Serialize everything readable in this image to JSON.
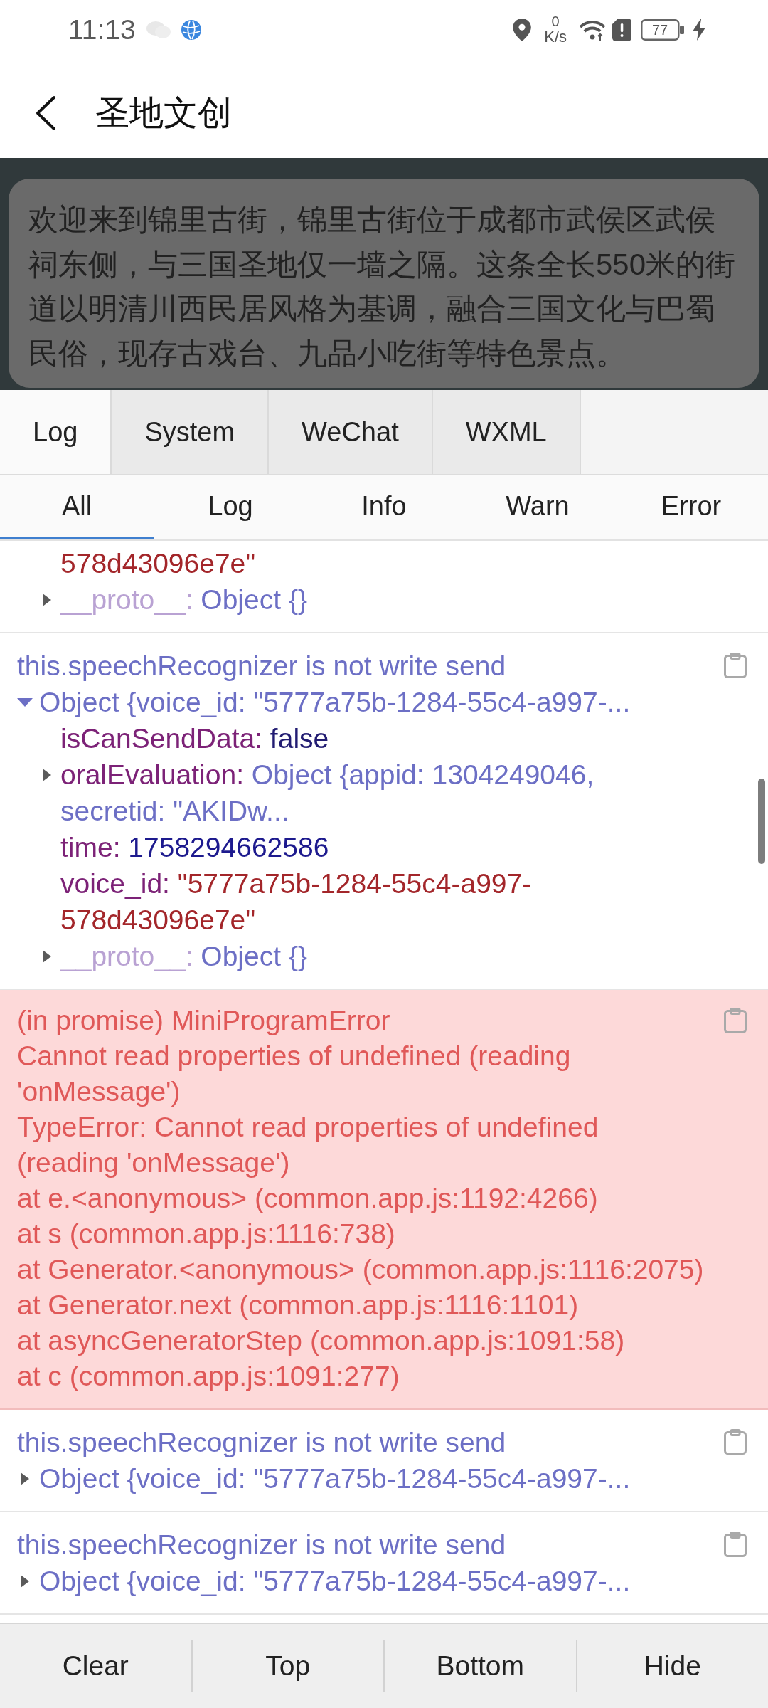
{
  "status_bar": {
    "time": "11:13",
    "net_speed": "0",
    "net_unit": "K/s",
    "battery": "77",
    "charging": true
  },
  "header": {
    "title": "圣地文创"
  },
  "banner": {
    "text": "欢迎来到锦里古街，锦里古街位于成都市武侯区武侯祠东侧，与三国圣地仅一墙之隔。这条全长550米的街道以明清川西民居风格为基调，融合三国文化与巴蜀民俗，现存古戏台、九品小吃街等特色景点。"
  },
  "devtools": {
    "tabs": [
      {
        "label": "Log",
        "selected": true
      },
      {
        "label": "System",
        "selected": false
      },
      {
        "label": "WeChat",
        "selected": false
      },
      {
        "label": "WXML",
        "selected": false
      }
    ],
    "filters": [
      {
        "label": "All",
        "selected": true
      },
      {
        "label": "Log",
        "selected": false
      },
      {
        "label": "Info",
        "selected": false
      },
      {
        "label": "Warn",
        "selected": false
      },
      {
        "label": "Error",
        "selected": false
      }
    ],
    "entries": [
      {
        "kind": "log",
        "object": {
          "children": [
            {
              "kind": "string",
              "value": "578d43096e7e\""
            },
            {
              "kind": "proto",
              "key": "__proto__:",
              "value": "Object {}",
              "expanded": false
            }
          ]
        }
      },
      {
        "kind": "log",
        "message": [
          "this.speechRecognizer is not write send"
        ],
        "object": {
          "summary": "Object {voice_id: \"5777a75b-1284-55c4-a997-...",
          "expanded": true,
          "children": [
            {
              "kind": "boolean",
              "key": "isCanSendData:",
              "value": "false"
            },
            {
              "kind": "object",
              "key": "oralEvaluation:",
              "value": "Object {appid: 1304249046, secretid: \"AKIDw...",
              "expanded": false
            },
            {
              "kind": "number",
              "key": "time:",
              "value": "1758294662586"
            },
            {
              "kind": "string",
              "key": "voice_id:",
              "value": "\"5777a75b-1284-55c4-a997-578d43096e7e\""
            },
            {
              "kind": "proto",
              "key": "__proto__:",
              "value": "Object {}",
              "expanded": false
            }
          ]
        }
      },
      {
        "kind": "error",
        "message": [
          "(in promise) MiniProgramError",
          "Cannot read properties of undefined (reading",
          "'onMessage')",
          "TypeError: Cannot read properties of undefined",
          "(reading 'onMessage')",
          "at e.<anonymous> (common.app.js:1192:4266)",
          "at s (common.app.js:1116:738)",
          "at Generator.<anonymous> (common.app.js:1116:2075)",
          "at Generator.next (common.app.js:1116:1101)",
          "at asyncGeneratorStep (common.app.js:1091:58)",
          "at c (common.app.js:1091:277)"
        ]
      },
      {
        "kind": "log",
        "message": [
          "this.speechRecognizer is not write send"
        ],
        "object": {
          "summary": "Object {voice_id: \"5777a75b-1284-55c4-a997-...",
          "expanded": false
        }
      },
      {
        "kind": "log",
        "message": [
          "this.speechRecognizer is not write send"
        ],
        "object": {
          "summary": "Object {voice_id: \"5777a75b-1284-55c4-a997-...",
          "expanded": false
        }
      }
    ],
    "toolbar": [
      "Clear",
      "Top",
      "Bottom",
      "Hide"
    ]
  }
}
